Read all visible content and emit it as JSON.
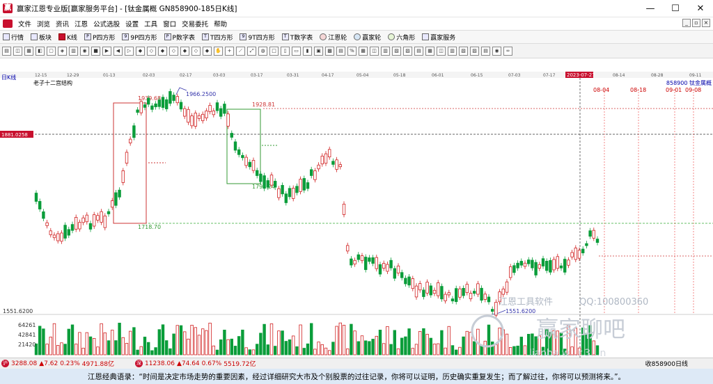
{
  "window": {
    "title": "赢家江恩专业版[赢家服务平台] - [钛金属概  GN858900-185日K线]",
    "minimize": "—",
    "maximize": "☐",
    "close": "✕"
  },
  "menu": [
    "文件",
    "浏览",
    "资讯",
    "江恩",
    "公式选股",
    "设置",
    "工具",
    "窗口",
    "交易委托",
    "帮助"
  ],
  "mdi": [
    "_",
    "▫",
    "×"
  ],
  "toolbar": [
    {
      "label": "行情"
    },
    {
      "label": "板块"
    },
    {
      "label": "K线"
    },
    {
      "label": "P四方形"
    },
    {
      "label": "9P四方形"
    },
    {
      "label": "P数字表"
    },
    {
      "label": "T四方形"
    },
    {
      "label": "9T四方形"
    },
    {
      "label": "T数字表"
    },
    {
      "label": "江恩轮"
    },
    {
      "label": "赢家轮"
    },
    {
      "label": "六角形"
    },
    {
      "label": "赢家服务"
    }
  ],
  "chart": {
    "period_label": "日K线",
    "indicator_label": "老子十二宫结构",
    "code_label": "858900  钛金属概",
    "crosshair_price": "1881.0258",
    "crosshair_date": "2023-07-27",
    "date_ticks": [
      "12-15",
      "12-29",
      "01-13",
      "02-03",
      "02-17",
      "03-03",
      "03-17",
      "03-31",
      "04-17",
      "05-04",
      "05-18",
      "06-01",
      "06-15",
      "07-03",
      "07-17",
      "08-14",
      "08-28",
      "09-11"
    ],
    "future_dates": [
      "08-04",
      "08-18",
      "09-01",
      "09-08"
    ],
    "annotations": {
      "high1": "1939.68",
      "high2": "1966.2500",
      "high3": "1928.81",
      "low1": "1791.24",
      "low2": "1718.70",
      "low3": "1551.6200"
    },
    "left_axis_price": "1551.6200",
    "volume_axis": [
      "64261",
      "42841",
      "21420"
    ],
    "watermark": {
      "tool": "江恩工具软件",
      "qq": "QQ:100800360",
      "brand": "赢家聊吧",
      "url": "liaoba.w...r.3...n"
    }
  },
  "status": {
    "sh_index": "3288.08",
    "sh_change": "▲7.62",
    "sh_pct": "0.23%",
    "sh_amount": "4971.88亿",
    "sz_index": "11238.06",
    "sz_change": "▲74.64",
    "sz_pct": "0.67%",
    "sz_amount": "5519.72亿",
    "right_label": "收858900日线"
  },
  "quote": "江恩经典语录：“时间是决定市场走势的重要因素，经过详细研究大市及个别股票的过往记录，你将可以证明，历史确实重复发生；而了解过往，你将可以预测将来。”。"
}
